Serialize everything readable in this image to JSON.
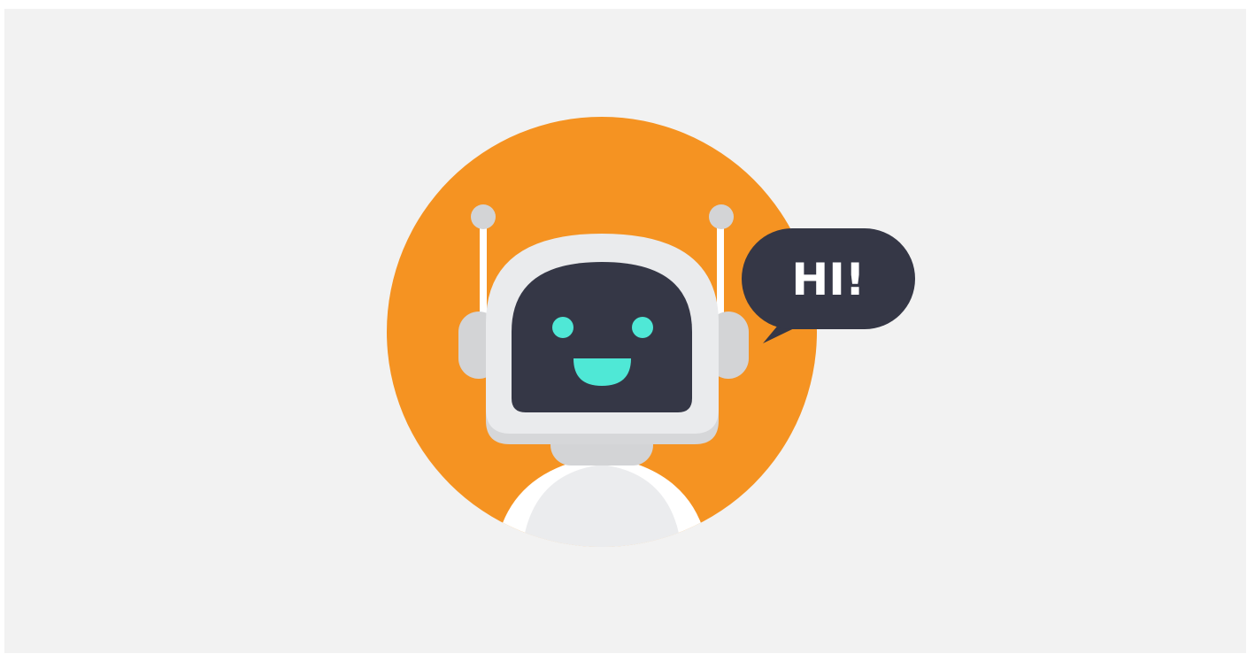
{
  "illustration": {
    "speech_bubble_text": "HI!",
    "colors": {
      "background": "#f2f2f2",
      "circle": "#f59322",
      "robot_shell": "#e9eaec",
      "robot_shade": "#d3d4d6",
      "screen": "#353746",
      "face": "#4fe8d6",
      "bubble": "#353746"
    },
    "icons": [
      "robot-icon",
      "speech-bubble-icon"
    ]
  }
}
